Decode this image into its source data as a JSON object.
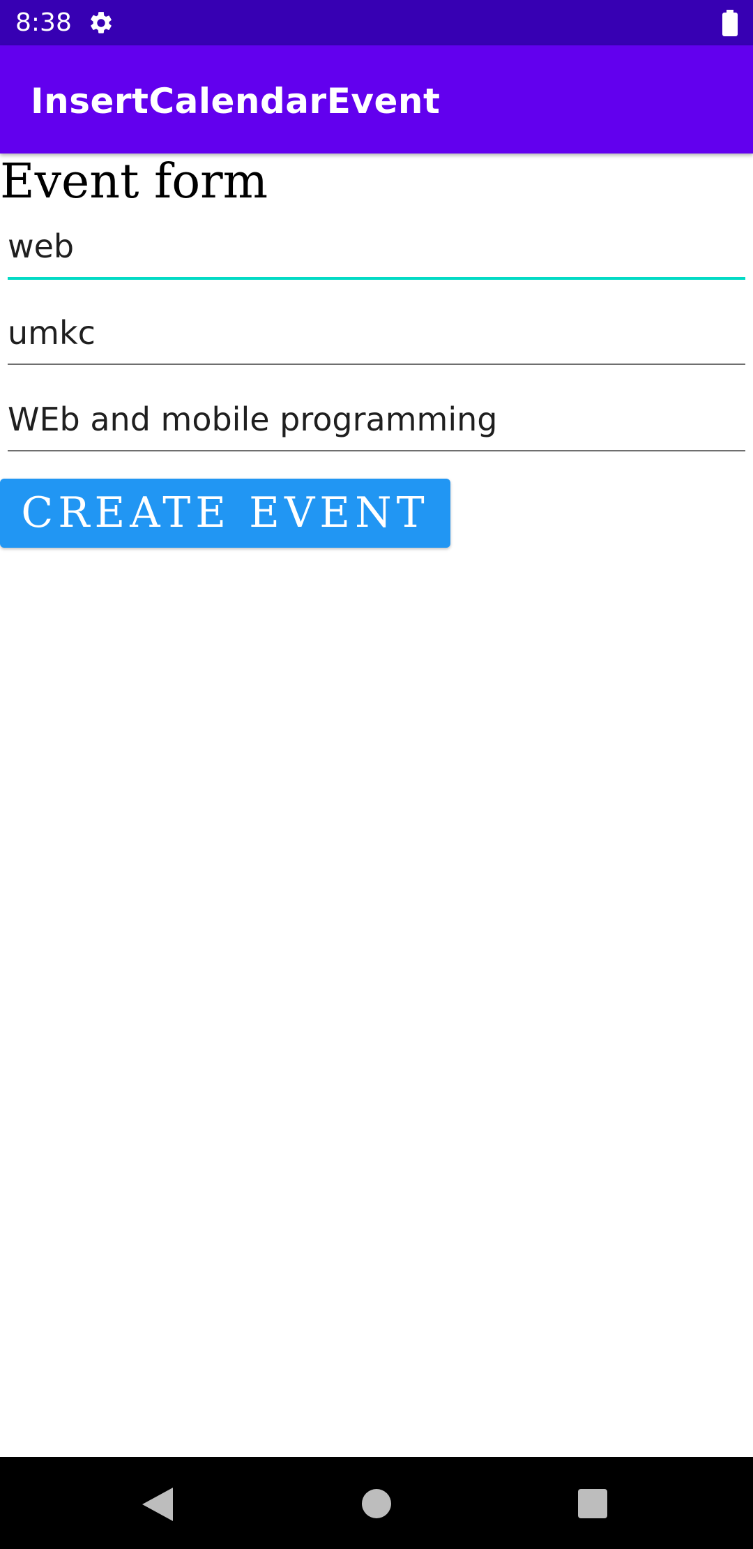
{
  "status_bar": {
    "time": "8:38",
    "icons": [
      "gear-icon",
      "battery-icon"
    ],
    "color": "#3700b3"
  },
  "app_bar": {
    "title": "InsertCalendarEvent",
    "color": "#6200ee"
  },
  "form": {
    "heading": "Event form",
    "fields": [
      {
        "value": "web",
        "focused": true
      },
      {
        "value": "umkc",
        "focused": false
      },
      {
        "value": "WEb and mobile programming",
        "focused": false
      }
    ],
    "submit_label": "CREATE EVENT",
    "submit_color": "#2196f3",
    "focus_color": "#03dac5"
  },
  "nav_bar": {
    "icons": [
      "back-icon",
      "home-icon",
      "recents-icon"
    ]
  }
}
